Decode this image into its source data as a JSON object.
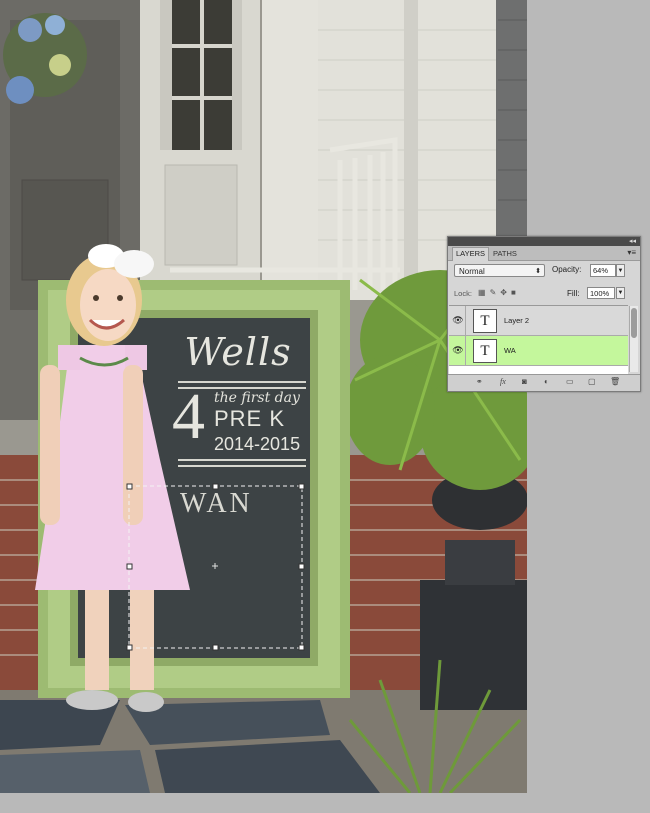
{
  "photo": {
    "chalkboard": {
      "name": "Wells",
      "subtitle": "the first day",
      "number": "4",
      "grade": "PRE K",
      "year": "2014-2015",
      "typed_text": "WAN"
    }
  },
  "layers_panel": {
    "tabs": [
      {
        "label": "LAYERS",
        "active": true
      },
      {
        "label": "PATHS",
        "active": false
      }
    ],
    "collapse_glyph": "◂◂",
    "menu_glyph": "▾≡",
    "blend_mode": "Normal",
    "opacity_label": "Opacity:",
    "opacity_value": "64%",
    "lock_label": "Lock:",
    "fill_label": "Fill:",
    "fill_value": "100%",
    "layers": [
      {
        "name": "Layer 2",
        "thumb": "T",
        "selected": false
      },
      {
        "name": "WA",
        "thumb": "T",
        "selected": true
      }
    ],
    "bottom_icons": [
      "link-icon",
      "fx-icon",
      "mask-icon",
      "adjustment-icon",
      "group-icon",
      "new-layer-icon",
      "trash-icon"
    ],
    "colors": {
      "selected_layer": "#c4f79c",
      "panel_bg": "#d6d6d6"
    }
  }
}
